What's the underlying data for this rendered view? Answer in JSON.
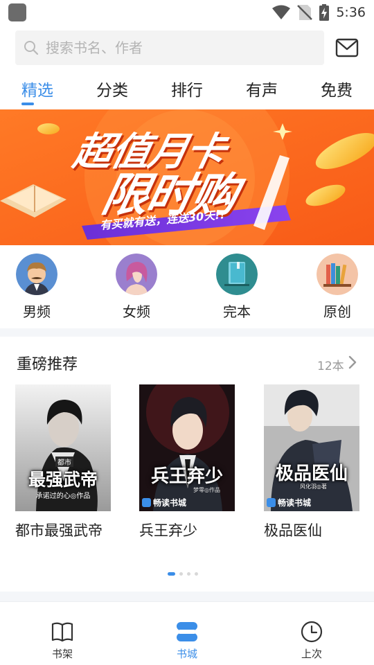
{
  "status_bar": {
    "time": "5:36"
  },
  "search": {
    "placeholder": "搜索书名、作者"
  },
  "tabs": [
    {
      "label": "精选",
      "active": true
    },
    {
      "label": "分类",
      "active": false
    },
    {
      "label": "排行",
      "active": false
    },
    {
      "label": "有声",
      "active": false
    },
    {
      "label": "免费",
      "active": false
    }
  ],
  "banner": {
    "line1": "超值月卡",
    "line2": "限时购",
    "tagline": "有买就有送，连送30天!!"
  },
  "categories": [
    {
      "label": "男频",
      "icon": "male-avatar-icon"
    },
    {
      "label": "女频",
      "icon": "female-avatar-icon"
    },
    {
      "label": "完本",
      "icon": "book-icon"
    },
    {
      "label": "原创",
      "icon": "bookshelf-icon"
    }
  ],
  "section": {
    "title": "重磅推荐",
    "count": "12本"
  },
  "books": [
    {
      "title": "都市最强武帝",
      "cover_title": "最强武帝",
      "cover_tag": "都市",
      "cover_author": "承诺过的心◎作品"
    },
    {
      "title": "兵王弃少",
      "cover_title": "兵王弃少",
      "cover_author": "梦零◎作品",
      "cover_brand": "畅读书城"
    },
    {
      "title": "极品医仙",
      "cover_title": "极品医仙",
      "cover_author": "风化羽◎著",
      "cover_brand": "畅读书城"
    }
  ],
  "pager": {
    "count": 4,
    "active": 0
  },
  "bottom_nav": [
    {
      "label": "书架",
      "icon": "bookshelf-nav-icon",
      "active": false
    },
    {
      "label": "书城",
      "icon": "bookstore-nav-icon",
      "active": true
    },
    {
      "label": "上次",
      "icon": "history-clock-icon",
      "active": false
    }
  ],
  "colors": {
    "accent": "#3b8ee8",
    "banner_orange": "#fb6a1e",
    "banner_purple": "#6b2fd6"
  }
}
